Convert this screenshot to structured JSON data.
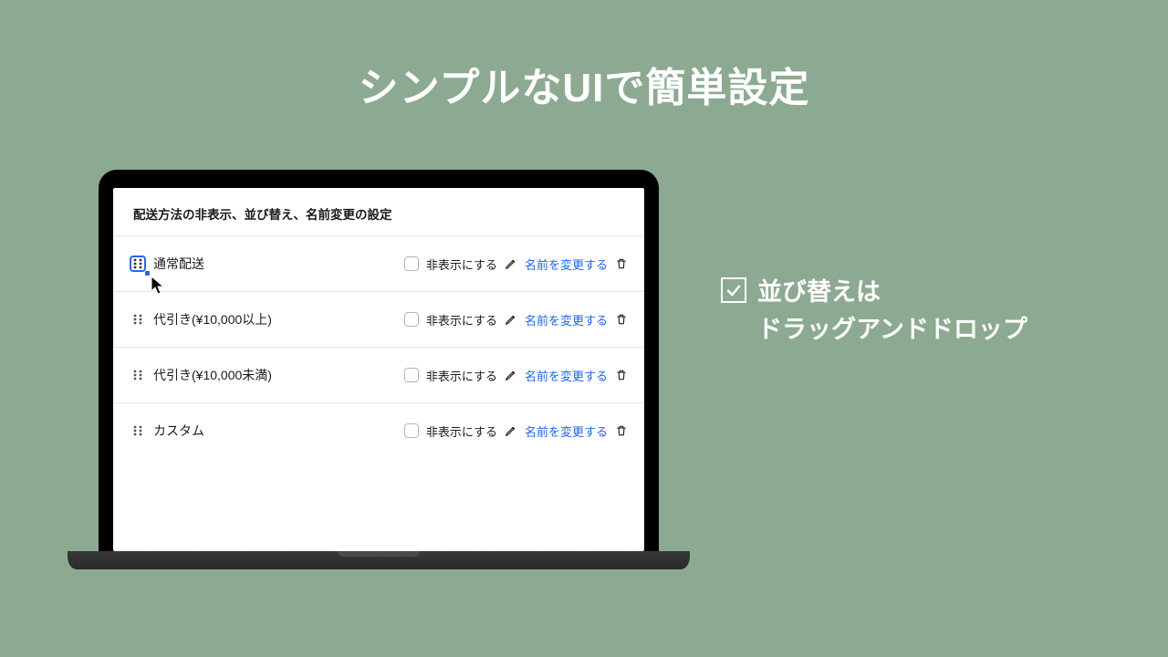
{
  "headline": "シンプルなUIで簡単設定",
  "panel_title": "配送方法の非表示、並び替え、名前変更の設定",
  "hide_label": "非表示にする",
  "rename_label": "名前を変更する",
  "rows": [
    {
      "name": "通常配送"
    },
    {
      "name": "代引き(¥10,000以上)"
    },
    {
      "name": "代引き(¥10,000未満)"
    },
    {
      "name": "カスタム"
    }
  ],
  "callout": {
    "line1": "並び替えは",
    "line2": "ドラッグアンドドロップ"
  }
}
